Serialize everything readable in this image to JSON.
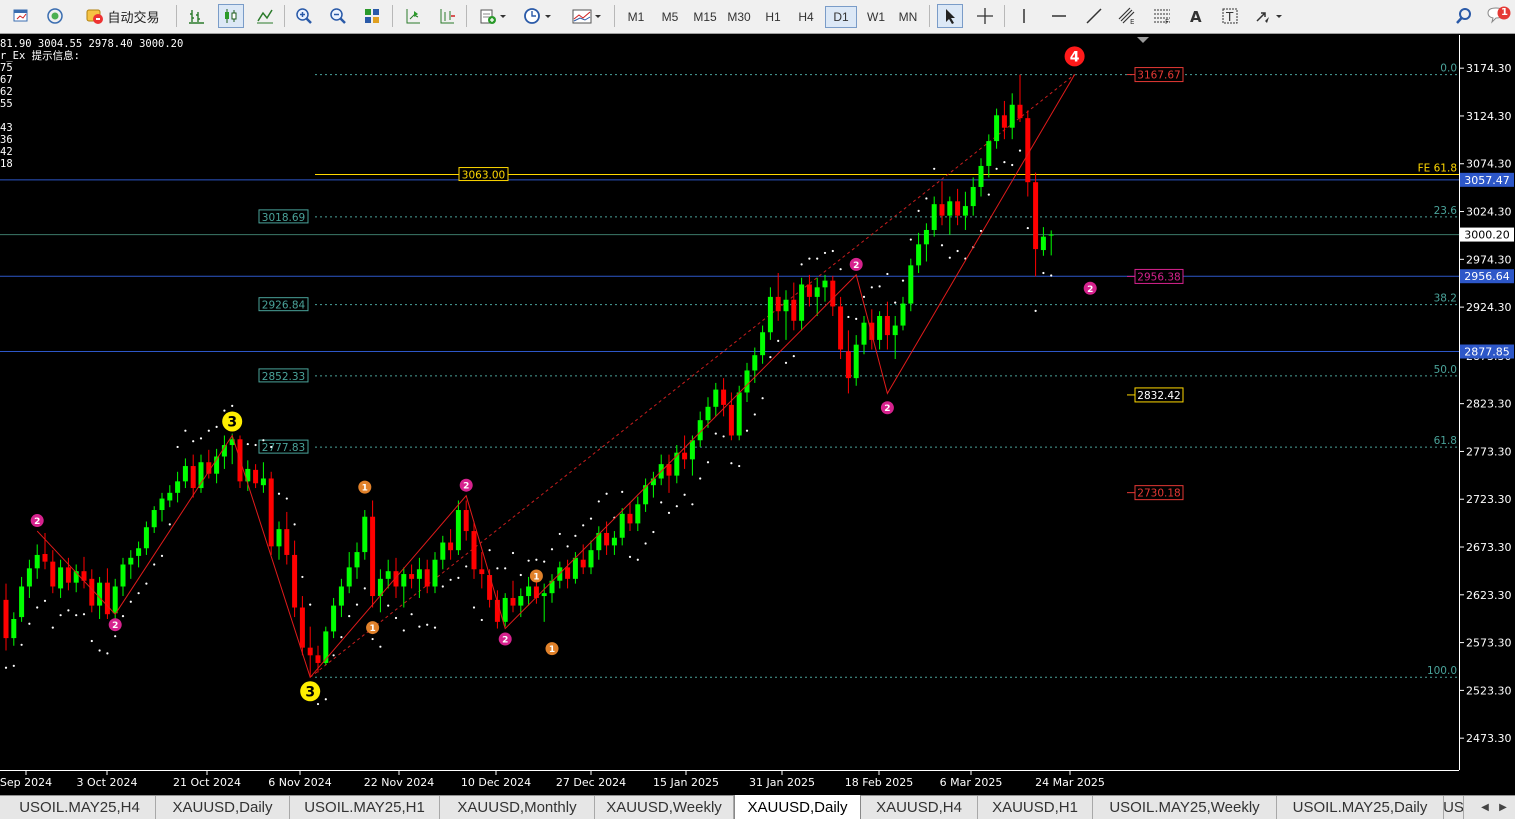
{
  "toolbar": {
    "auto_trade_label": "自动交易",
    "timeframes": [
      "M1",
      "M5",
      "M15",
      "M30",
      "H1",
      "H4",
      "D1",
      "W1",
      "MN"
    ],
    "active_timeframe": "D1",
    "notification_count": "1"
  },
  "info_lines": [
    "81.90 3004.55 2978.40 3000.20",
    "r_Ex 提示信息:",
    "75",
    "67",
    "62",
    "55",
    "",
    "43",
    "36",
    "42",
    "18"
  ],
  "colors": {
    "background": "#000000",
    "bull": "#00ff00",
    "bear": "#ff0000",
    "grid_dotted": "#4aa39a",
    "hline_blue": "#2d57c8",
    "fe_line": "#ffd800",
    "wave_pink": "#d6228e",
    "wave_orange": "#e0812a",
    "wave_yellow": "#ffee00",
    "wave_red": "#ff1a1a"
  },
  "chart_data": {
    "type": "candlestick",
    "symbol": "XAUUSD",
    "timeframe": "D1",
    "ylim": [
      2440.0,
      3209.0
    ],
    "yticks": [
      3174.3,
      3124.3,
      3074.3,
      3024.3,
      2974.3,
      2924.3,
      2873.3,
      2823.3,
      2773.3,
      2723.3,
      2673.3,
      2623.3,
      2573.3,
      2523.3,
      2473.3
    ],
    "xticks": [
      "Sep 2024",
      "3 Oct 2024",
      "21 Oct 2024",
      "6 Nov 2024",
      "22 Nov 2024",
      "10 Dec 2024",
      "27 Dec 2024",
      "15 Jan 2025",
      "31 Jan 2025",
      "18 Feb 2025",
      "6 Mar 2025",
      "24 Mar 2025"
    ],
    "fib_levels": [
      {
        "label": "0.0",
        "price": 3167.6
      },
      {
        "label": "FE 61.8",
        "price": 3063.0
      },
      {
        "label": "23.6",
        "price": 3018.69
      },
      {
        "label": "38.2",
        "price": 2926.84
      },
      {
        "label": "50.0",
        "price": 2852.33
      },
      {
        "label": "61.8",
        "price": 2777.83
      },
      {
        "label": "100.0",
        "price": 2537.1
      }
    ],
    "level_labels": [
      {
        "text": "3063.00",
        "price": 3063.0
      },
      {
        "text": "3018.69",
        "price": 3018.69
      },
      {
        "text": "2926.84",
        "price": 2926.84
      },
      {
        "text": "2852.33",
        "price": 2852.33
      },
      {
        "text": "2777.83",
        "price": 2777.83
      }
    ],
    "h_lines": [
      3057.47,
      3000.2,
      2956.64,
      2877.85
    ],
    "price_markers": [
      {
        "text": "3057.47",
        "price": 3057.47,
        "style": "blue"
      },
      {
        "text": "3000.20",
        "price": 3000.2,
        "style": "white"
      },
      {
        "text": "2956.64",
        "price": 2956.64,
        "style": "blue"
      },
      {
        "text": "2877.85",
        "price": 2877.85,
        "style": "blue"
      }
    ],
    "target_boxes": [
      {
        "text": "3167.67",
        "price": 3167.6,
        "style": "red"
      },
      {
        "text": "2956.38",
        "price": 2956.4,
        "style": "pinkline"
      },
      {
        "text": "2832.42",
        "price": 2832.42,
        "style": "yellow"
      },
      {
        "text": "2730.18",
        "price": 2730.18,
        "style": "red"
      }
    ],
    "waves": [
      {
        "label": "2",
        "bar": 4,
        "price": 2690,
        "pos": "above",
        "color": "pink"
      },
      {
        "label": "2",
        "bar": 14,
        "price": 2603,
        "pos": "below",
        "color": "pink"
      },
      {
        "label": "3",
        "bar": 29,
        "price": 2790,
        "pos": "above",
        "color": "yellow"
      },
      {
        "label": "3",
        "bar": 39,
        "price": 2537,
        "pos": "below",
        "color": "yellow"
      },
      {
        "label": "1",
        "bar": 46,
        "price": 2725,
        "pos": "above",
        "color": "orange"
      },
      {
        "label": "1",
        "bar": 47,
        "price": 2600,
        "pos": "below",
        "color": "orange"
      },
      {
        "label": "2",
        "bar": 59,
        "price": 2727,
        "pos": "above",
        "color": "pink"
      },
      {
        "label": "2",
        "bar": 64,
        "price": 2588,
        "pos": "below",
        "color": "pink"
      },
      {
        "label": "1",
        "bar": 68,
        "price": 2632,
        "pos": "above",
        "color": "orange"
      },
      {
        "label": "1",
        "bar": 70,
        "price": 2578,
        "pos": "below",
        "color": "orange"
      },
      {
        "label": "2",
        "bar": 109,
        "price": 2958,
        "pos": "above",
        "color": "pink"
      },
      {
        "label": "2",
        "bar": 113,
        "price": 2830,
        "pos": "below",
        "color": "pink"
      },
      {
        "label": "4",
        "bar": 137,
        "price": 3172,
        "pos": "above",
        "color": "red"
      },
      {
        "label": "2",
        "bar": 139,
        "price": 2955,
        "pos": "below",
        "color": "pink"
      }
    ],
    "zigzag": [
      [
        4,
        2690
      ],
      [
        14,
        2603
      ],
      [
        29,
        2790
      ],
      [
        39,
        2537
      ],
      [
        59,
        2727
      ],
      [
        64,
        2588
      ],
      [
        109,
        2958
      ],
      [
        113,
        2834
      ],
      [
        137,
        3167.6
      ]
    ],
    "projection_lines": [
      [
        39,
        2537
      ],
      [
        137,
        3167.6
      ]
    ],
    "candles": [
      [
        2618,
        2635,
        2565,
        2578
      ],
      [
        2578,
        2605,
        2570,
        2598
      ],
      [
        2600,
        2642,
        2595,
        2632
      ],
      [
        2632,
        2660,
        2620,
        2651
      ],
      [
        2651,
        2676,
        2640,
        2665
      ],
      [
        2666,
        2688,
        2650,
        2658
      ],
      [
        2658,
        2670,
        2625,
        2632
      ],
      [
        2630,
        2660,
        2620,
        2652
      ],
      [
        2652,
        2662,
        2628,
        2636
      ],
      [
        2636,
        2655,
        2626,
        2648
      ],
      [
        2648,
        2663,
        2630,
        2638
      ],
      [
        2640,
        2650,
        2605,
        2612
      ],
      [
        2612,
        2642,
        2598,
        2636
      ],
      [
        2636,
        2651,
        2598,
        2603
      ],
      [
        2604,
        2640,
        2598,
        2632
      ],
      [
        2632,
        2662,
        2622,
        2655
      ],
      [
        2655,
        2670,
        2640,
        2662
      ],
      [
        2664,
        2679,
        2652,
        2672
      ],
      [
        2672,
        2700,
        2665,
        2694
      ],
      [
        2694,
        2716,
        2688,
        2712
      ],
      [
        2712,
        2730,
        2700,
        2724
      ],
      [
        2722,
        2738,
        2715,
        2730
      ],
      [
        2730,
        2752,
        2720,
        2742
      ],
      [
        2742,
        2766,
        2735,
        2758
      ],
      [
        2758,
        2770,
        2725,
        2735
      ],
      [
        2735,
        2770,
        2730,
        2762
      ],
      [
        2762,
        2775,
        2745,
        2750
      ],
      [
        2750,
        2776,
        2740,
        2768
      ],
      [
        2768,
        2790,
        2755,
        2780
      ],
      [
        2780,
        2792,
        2760,
        2786
      ],
      [
        2786,
        2790,
        2735,
        2742
      ],
      [
        2742,
        2764,
        2732,
        2755
      ],
      [
        2754,
        2760,
        2735,
        2740
      ],
      [
        2738,
        2762,
        2730,
        2745
      ],
      [
        2745,
        2752,
        2665,
        2674
      ],
      [
        2674,
        2700,
        2660,
        2692
      ],
      [
        2692,
        2710,
        2655,
        2665
      ],
      [
        2665,
        2680,
        2600,
        2610
      ],
      [
        2610,
        2622,
        2560,
        2568
      ],
      [
        2568,
        2590,
        2537,
        2560
      ],
      [
        2560,
        2570,
        2542,
        2552
      ],
      [
        2552,
        2590,
        2550,
        2585
      ],
      [
        2585,
        2620,
        2578,
        2612
      ],
      [
        2612,
        2640,
        2600,
        2632
      ],
      [
        2632,
        2668,
        2625,
        2652
      ],
      [
        2652,
        2678,
        2640,
        2668
      ],
      [
        2668,
        2712,
        2660,
        2705
      ],
      [
        2705,
        2722,
        2610,
        2622
      ],
      [
        2622,
        2650,
        2605,
        2640
      ],
      [
        2640,
        2660,
        2630,
        2648
      ],
      [
        2648,
        2662,
        2620,
        2632
      ],
      [
        2632,
        2652,
        2610,
        2645
      ],
      [
        2645,
        2655,
        2630,
        2640
      ],
      [
        2640,
        2662,
        2620,
        2650
      ],
      [
        2650,
        2660,
        2625,
        2632
      ],
      [
        2632,
        2668,
        2625,
        2660
      ],
      [
        2660,
        2685,
        2650,
        2678
      ],
      [
        2678,
        2692,
        2660,
        2670
      ],
      [
        2670,
        2722,
        2665,
        2712
      ],
      [
        2712,
        2722,
        2680,
        2690
      ],
      [
        2690,
        2700,
        2640,
        2650
      ],
      [
        2650,
        2668,
        2630,
        2645
      ],
      [
        2644,
        2650,
        2610,
        2618
      ],
      [
        2618,
        2628,
        2588,
        2595
      ],
      [
        2595,
        2625,
        2590,
        2620
      ],
      [
        2620,
        2638,
        2605,
        2612
      ],
      [
        2612,
        2630,
        2600,
        2622
      ],
      [
        2622,
        2642,
        2612,
        2632
      ],
      [
        2632,
        2640,
        2614,
        2620
      ],
      [
        2622,
        2635,
        2595,
        2625
      ],
      [
        2625,
        2645,
        2615,
        2638
      ],
      [
        2638,
        2658,
        2630,
        2652
      ],
      [
        2652,
        2660,
        2630,
        2640
      ],
      [
        2640,
        2668,
        2635,
        2662
      ],
      [
        2660,
        2676,
        2645,
        2652
      ],
      [
        2652,
        2680,
        2645,
        2670
      ],
      [
        2670,
        2695,
        2660,
        2688
      ],
      [
        2688,
        2700,
        2665,
        2675
      ],
      [
        2675,
        2690,
        2665,
        2683
      ],
      [
        2683,
        2714,
        2675,
        2708
      ],
      [
        2708,
        2720,
        2690,
        2698
      ],
      [
        2698,
        2726,
        2690,
        2718
      ],
      [
        2718,
        2745,
        2710,
        2738
      ],
      [
        2738,
        2752,
        2725,
        2745
      ],
      [
        2745,
        2770,
        2738,
        2760
      ],
      [
        2760,
        2770,
        2730,
        2748
      ],
      [
        2748,
        2780,
        2740,
        2772
      ],
      [
        2772,
        2790,
        2755,
        2765
      ],
      [
        2765,
        2790,
        2748,
        2785
      ],
      [
        2785,
        2815,
        2778,
        2806
      ],
      [
        2806,
        2830,
        2798,
        2820
      ],
      [
        2820,
        2845,
        2810,
        2838
      ],
      [
        2838,
        2850,
        2810,
        2822
      ],
      [
        2822,
        2835,
        2785,
        2790
      ],
      [
        2790,
        2842,
        2785,
        2835
      ],
      [
        2835,
        2866,
        2825,
        2858
      ],
      [
        2858,
        2882,
        2845,
        2874
      ],
      [
        2874,
        2905,
        2865,
        2898
      ],
      [
        2898,
        2945,
        2890,
        2935
      ],
      [
        2935,
        2960,
        2910,
        2920
      ],
      [
        2920,
        2942,
        2890,
        2932
      ],
      [
        2932,
        2950,
        2900,
        2910
      ],
      [
        2910,
        2955,
        2900,
        2948
      ],
      [
        2948,
        2958,
        2925,
        2935
      ],
      [
        2935,
        2955,
        2915,
        2945
      ],
      [
        2945,
        2958,
        2930,
        2952
      ],
      [
        2952,
        2957,
        2915,
        2925
      ],
      [
        2925,
        2935,
        2870,
        2880
      ],
      [
        2878,
        2900,
        2834,
        2850
      ],
      [
        2850,
        2895,
        2842,
        2885
      ],
      [
        2885,
        2915,
        2875,
        2908
      ],
      [
        2908,
        2922,
        2880,
        2890
      ],
      [
        2890,
        2920,
        2880,
        2915
      ],
      [
        2915,
        2930,
        2880,
        2895
      ],
      [
        2895,
        2915,
        2870,
        2905
      ],
      [
        2905,
        2935,
        2900,
        2928
      ],
      [
        2928,
        2975,
        2920,
        2968
      ],
      [
        2968,
        3002,
        2960,
        2990
      ],
      [
        2990,
        3012,
        2972,
        3005
      ],
      [
        3005,
        3040,
        2998,
        3032
      ],
      [
        3032,
        3056,
        3010,
        3020
      ],
      [
        3020,
        3040,
        3000,
        3035
      ],
      [
        3035,
        3048,
        3010,
        3020
      ],
      [
        3020,
        3045,
        3005,
        3030
      ],
      [
        3030,
        3060,
        3020,
        3050
      ],
      [
        3050,
        3080,
        3040,
        3072
      ],
      [
        3072,
        3105,
        3060,
        3098
      ],
      [
        3098,
        3132,
        3090,
        3125
      ],
      [
        3125,
        3140,
        3100,
        3112
      ],
      [
        3112,
        3148,
        3100,
        3136
      ],
      [
        3136,
        3167.6,
        3118,
        3122
      ],
      [
        3122,
        3130,
        3040,
        3055
      ],
      [
        3055,
        3065,
        2956.4,
        2985
      ],
      [
        2984,
        3008,
        2978,
        2998
      ],
      [
        3000,
        3004.55,
        2978.4,
        3000.2
      ]
    ]
  },
  "tabs": [
    "USOIL.MAY25,H4",
    "XAUUSD,Daily",
    "USOIL.MAY25,H1",
    "XAUUSD,Monthly",
    "XAUUSD,Weekly",
    "XAUUSD,Daily",
    "XAUUSD,H4",
    "XAUUSD,H1",
    "USOIL.MAY25,Weekly",
    "USOIL.MAY25,Daily",
    "US"
  ],
  "active_tab_index": 5
}
